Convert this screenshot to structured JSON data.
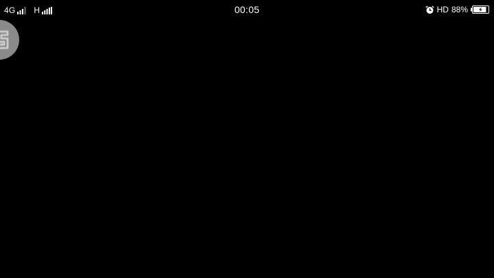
{
  "status_bar": {
    "network_primary": "4G",
    "network_secondary": "H",
    "time": "00:05",
    "alarm_icon": "alarm-clock-icon",
    "hd_label": "HD",
    "battery_percent": "88%",
    "battery_level": 0.88,
    "charging": true
  },
  "floating_assistant": {
    "icon": "floating-assistant-icon",
    "color": "#8a8a8a"
  },
  "colors": {
    "background": "#000000",
    "foreground": "#ffffff"
  }
}
